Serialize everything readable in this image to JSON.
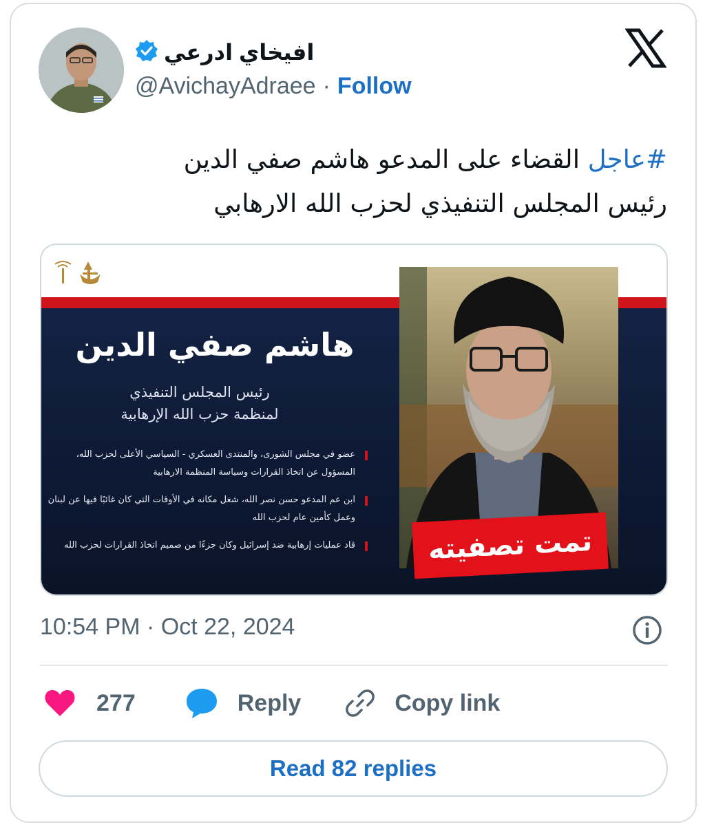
{
  "author": {
    "display_name": "افيخاي ادرعي",
    "handle": "@AvichayAdraee",
    "separator": "·",
    "follow_label": "Follow",
    "verified": true
  },
  "tweet": {
    "hashtag": "#عاجل",
    "text_line1": "القضاء على المدعو هاشم صفي الدين",
    "text_line2": "رئيس المجلس التنفيذي لحزب الله الارهابي"
  },
  "media": {
    "headline": "هاشم صفي الدين",
    "subtitle_line1": "رئيس المجلس التنفيذي",
    "subtitle_line2": "لمنظمة حزب الله الإرهابية",
    "bullets": [
      "عضو في مجلس الشورى، والمنتدى العسكري - السياسي الأعلى لحزب الله، المسؤول عن اتخاذ القرارات وسياسة المنظمة الارهابية",
      "ابن عم المدعو حسن نصر الله، شغل مكانه في الأوقات التي كان غائبًا فيها عن لبنان وعمل كأمين عام لحزب الله",
      "قاد عمليات إرهابية ضد إسرائيل وكان جزءًا من صميم اتخاذ القرارات لحزب الله"
    ],
    "stamp": "تمت تصفيته"
  },
  "meta": {
    "time": "10:54 PM",
    "date": "Oct 22, 2024",
    "dot": "·"
  },
  "actions": {
    "likes": "277",
    "reply_label": "Reply",
    "copy_label": "Copy link"
  },
  "read_replies_label": "Read 82 replies",
  "colors": {
    "link_blue": "#1d6fc4",
    "heart_pink": "#f91880",
    "reply_blue": "#1d9bf0",
    "banner_red": "#d0141b",
    "banner_navy": "#0d1933"
  }
}
